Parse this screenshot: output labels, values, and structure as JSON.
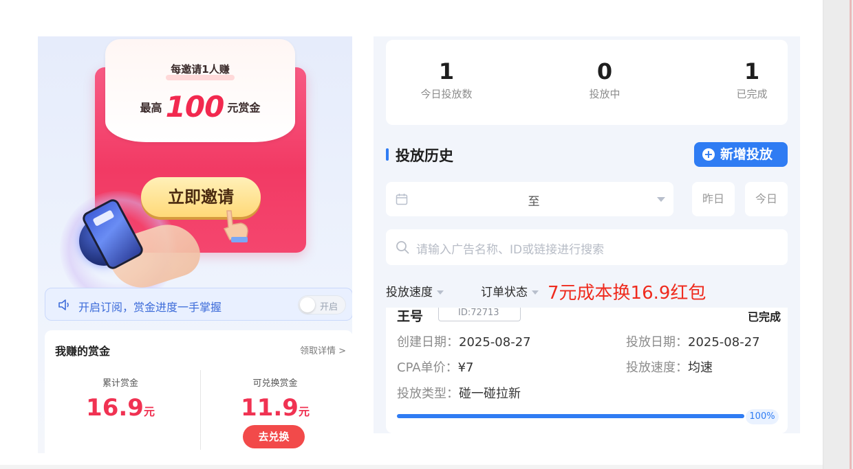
{
  "invite_banner": {
    "headline": "每邀请1人赚",
    "reward_prefix": "最高",
    "reward_amount": "100",
    "reward_suffix": "元赏金",
    "invite_button": "立即邀请"
  },
  "subscription": {
    "text": "开启订阅，赏金进度一手掌握",
    "toggle_label": "开启",
    "toggle_on": false
  },
  "earnings": {
    "title": "我赚的赏金",
    "detail_link": "领取详情 >",
    "total_label": "累计赏金",
    "total_value": "16.9",
    "total_unit": "元",
    "redeemable_label": "可兑换赏金",
    "redeemable_value": "11.9",
    "redeemable_unit": "元",
    "redeem_button": "去兑换"
  },
  "stats": [
    {
      "value": "1",
      "label": "今日投放数"
    },
    {
      "value": "0",
      "label": "投放中"
    },
    {
      "value": "1",
      "label": "已完成"
    }
  ],
  "history": {
    "title": "投放历史",
    "add_button": "新增投放",
    "date_separator": "至",
    "yesterday_chip": "昨日",
    "today_chip": "今日",
    "search_placeholder": "请输入广告名称、ID或链接进行搜索",
    "filter_speed": "投放速度",
    "filter_status": "订单状态"
  },
  "overlay_caption": "7元成本换16.9红包",
  "order": {
    "name": "王号",
    "id": "ID:72713",
    "status": "已完成",
    "created_label": "创建日期：",
    "created_value": "2025-08-27",
    "launch_label": "投放日期：",
    "launch_value": "2025-08-27",
    "cpa_label": "CPA单价：",
    "cpa_value": "¥7",
    "speed_label": "投放速度：",
    "speed_value": "均速",
    "type_label": "投放类型：",
    "type_value": "碰一碰拉新",
    "progress": 1.0,
    "progress_text": "100%"
  },
  "colors": {
    "accent_blue": "#2f7cf3",
    "reward_red": "#f2294f",
    "caption_red": "#ef2b1e"
  }
}
